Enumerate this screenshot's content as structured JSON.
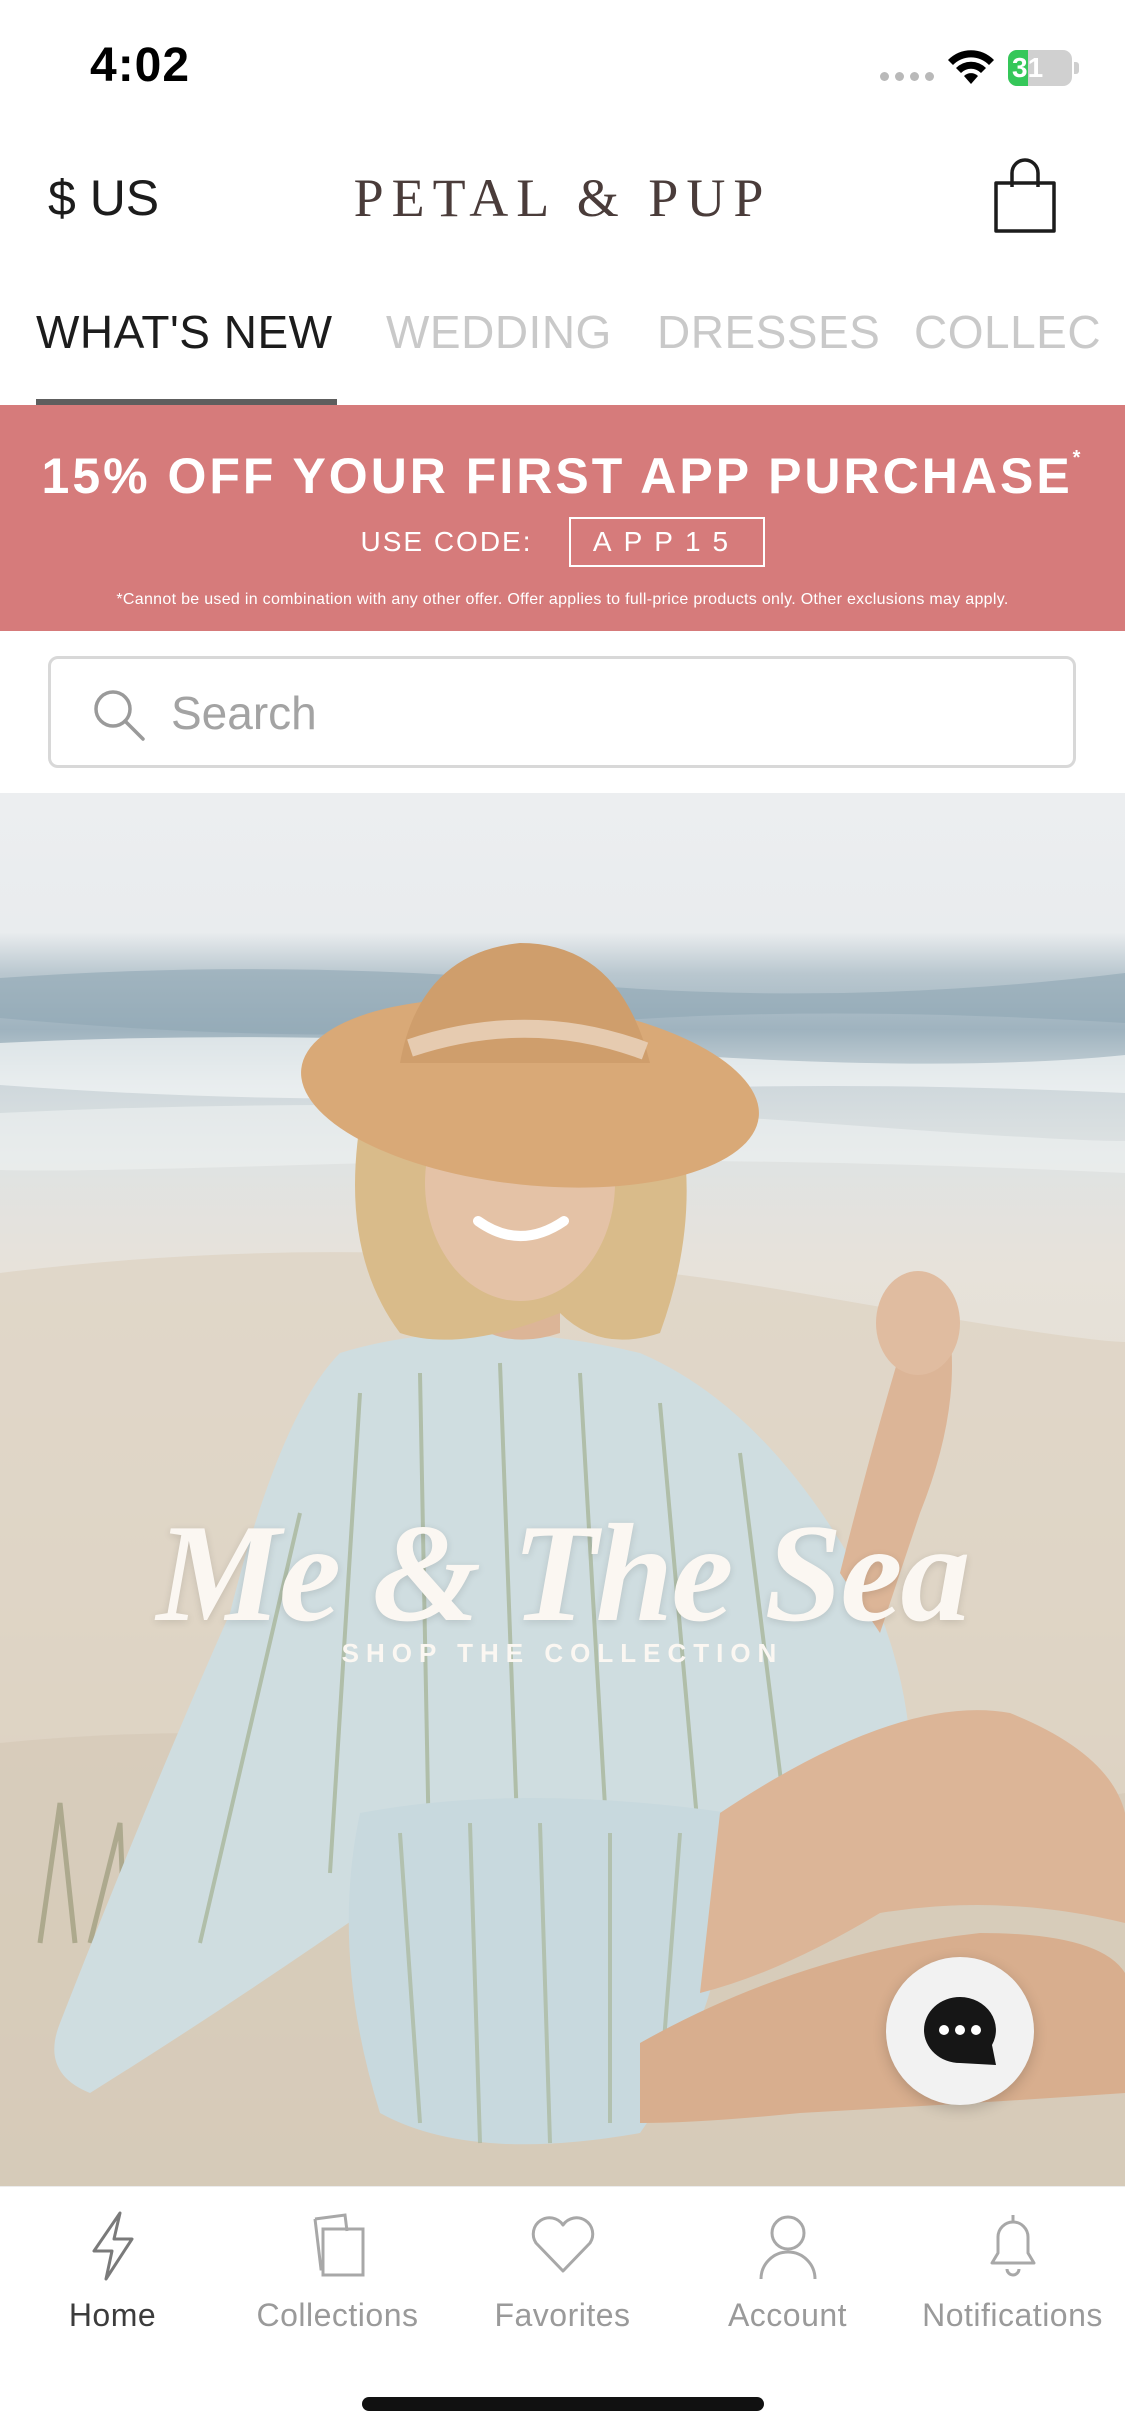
{
  "status_bar": {
    "time": "4:02",
    "battery_text": "31",
    "battery_level": 0.31,
    "battery_color": "#35c759"
  },
  "header": {
    "currency": "$ US",
    "logo": "PETAL & PUP",
    "cart_icon": "shopping-bag-icon"
  },
  "tabs": [
    {
      "label": "WHAT'S NEW",
      "active": true
    },
    {
      "label": "WEDDING",
      "active": false
    },
    {
      "label": "DRESSES",
      "active": false
    },
    {
      "label": "COLLEC",
      "active": false
    }
  ],
  "promo": {
    "headline": "15% OFF YOUR FIRST APP PURCHASE",
    "asterisk": "*",
    "code_label": "USE CODE:",
    "code": "APP15",
    "disclaimer": "*Cannot be used in combination with any other offer. Offer applies to full-price products only. Other exclusions may apply.",
    "background_color": "#d67b7b"
  },
  "search": {
    "placeholder": "Search",
    "value": "",
    "icon": "search-icon"
  },
  "hero": {
    "title": "Me & The Sea",
    "subtitle": "SHOP THE COLLECTION"
  },
  "chat": {
    "icon": "chat-bubble-icon"
  },
  "bottom_nav": [
    {
      "label": "Home",
      "icon": "lightning-icon",
      "active": true
    },
    {
      "label": "Collections",
      "icon": "collections-icon",
      "active": false
    },
    {
      "label": "Favorites",
      "icon": "heart-icon",
      "active": false
    },
    {
      "label": "Account",
      "icon": "person-icon",
      "active": false
    },
    {
      "label": "Notifications",
      "icon": "bell-icon",
      "active": false
    }
  ]
}
